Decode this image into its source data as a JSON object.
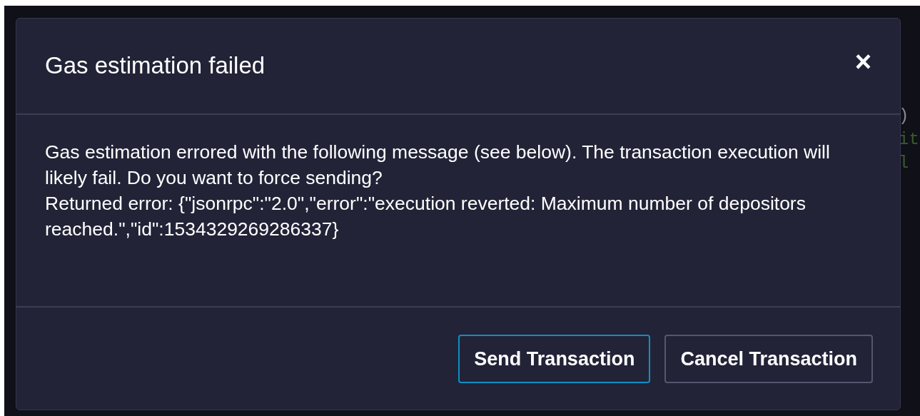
{
  "background_code": [
    ")",
    "it",
    "l"
  ],
  "dialog": {
    "title": "Gas estimation failed",
    "close": "×",
    "message": "Gas estimation errored with the following message (see below). The transaction execution will likely fail. Do you want to force sending?",
    "error": "Returned error: {\"jsonrpc\":\"2.0\",\"error\":\"execution reverted: Maximum number of depositors reached.\",\"id\":1534329269286337}",
    "buttons": [
      {
        "label": "Send Transaction",
        "selected": true
      },
      {
        "label": "Cancel Transaction",
        "selected": false
      }
    ]
  }
}
